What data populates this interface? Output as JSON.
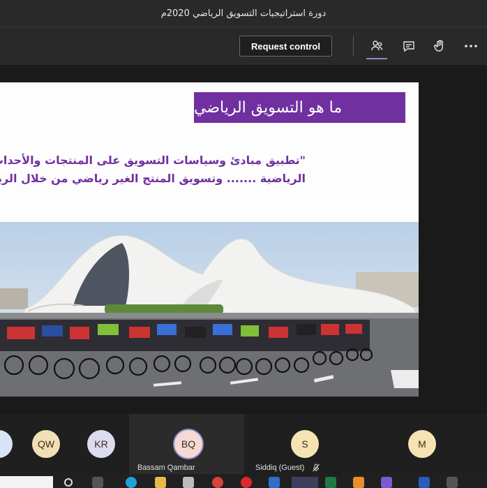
{
  "window": {
    "title": "دورة استراتيجيات التسويق الرياضي 2020م"
  },
  "toolbar": {
    "request_control_label": "Request control",
    "icons": [
      "participants-icon",
      "chat-icon",
      "raise-hand-icon",
      "more-options-icon"
    ]
  },
  "slide": {
    "title": "ما هو التسويق الرياضي",
    "line1": "\"تطبيق مبادئ وسياسات التسويق على المنتجات والأحداث",
    "line2": "الرياضية ....... وتسويق المنتج الغير رياضي من خلال الرياضة"
  },
  "participants": [
    {
      "initials": "QW",
      "name": "",
      "color": "#f1e0b5"
    },
    {
      "initials": "KR",
      "name": "",
      "color": "#dcdcf0"
    },
    {
      "initials": "BQ",
      "name": "Bassam Qambar",
      "color": "#f6d8d4"
    },
    {
      "initials": "S",
      "name": "Siddiq (Guest)",
      "color": "#f6e3b4"
    },
    {
      "initials": "M",
      "name": "",
      "color": "#f6e3b4"
    }
  ],
  "colors": {
    "accent": "#7030a0",
    "active_ring": "#8b8cc7"
  }
}
